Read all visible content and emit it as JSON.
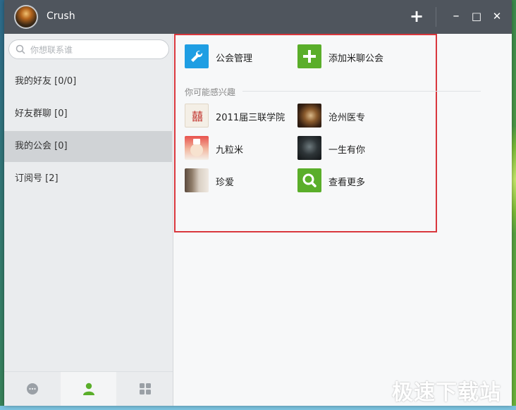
{
  "window": {
    "title": "Crush",
    "controls": {
      "add": "+",
      "minimize": "–",
      "maximize": "□",
      "close": "✕"
    }
  },
  "sidebar": {
    "search_placeholder": "你想联系谁",
    "items": [
      {
        "label": "我的好友  [0/0]",
        "active": false
      },
      {
        "label": "好友群聊  [0]",
        "active": false
      },
      {
        "label": "我的公会  [0]",
        "active": true
      },
      {
        "label": "订阅号  [2]",
        "active": false
      }
    ],
    "bottom_tabs": [
      {
        "icon": "chat-icon",
        "active": false
      },
      {
        "icon": "contacts-icon",
        "active": true
      },
      {
        "icon": "apps-grid-icon",
        "active": false
      }
    ]
  },
  "main": {
    "actions": [
      {
        "label": "公会管理",
        "icon": "wrench-icon",
        "color": "#1f9ee3"
      },
      {
        "label": "添加米聊公会",
        "icon": "plus-icon",
        "color": "#5aae2a"
      }
    ],
    "section_title": "你可能感兴趣",
    "suggestions": [
      {
        "label": "2011届三联学院",
        "icon": "guild-avatar-icon"
      },
      {
        "label": "沧州医专",
        "icon": "guild-avatar-icon"
      },
      {
        "label": "九粒米",
        "icon": "guild-avatar-icon"
      },
      {
        "label": "一生有你",
        "icon": "guild-avatar-icon"
      },
      {
        "label": "珍爱",
        "icon": "guild-avatar-icon"
      },
      {
        "label": "查看更多",
        "icon": "search-icon",
        "color": "#5aae2a"
      }
    ]
  },
  "watermark": "极速下载站",
  "colors": {
    "accent": "#5aae2a",
    "blue": "#1f9ee3",
    "highlight": "#d9373d",
    "titlebar": "#4f555d"
  }
}
